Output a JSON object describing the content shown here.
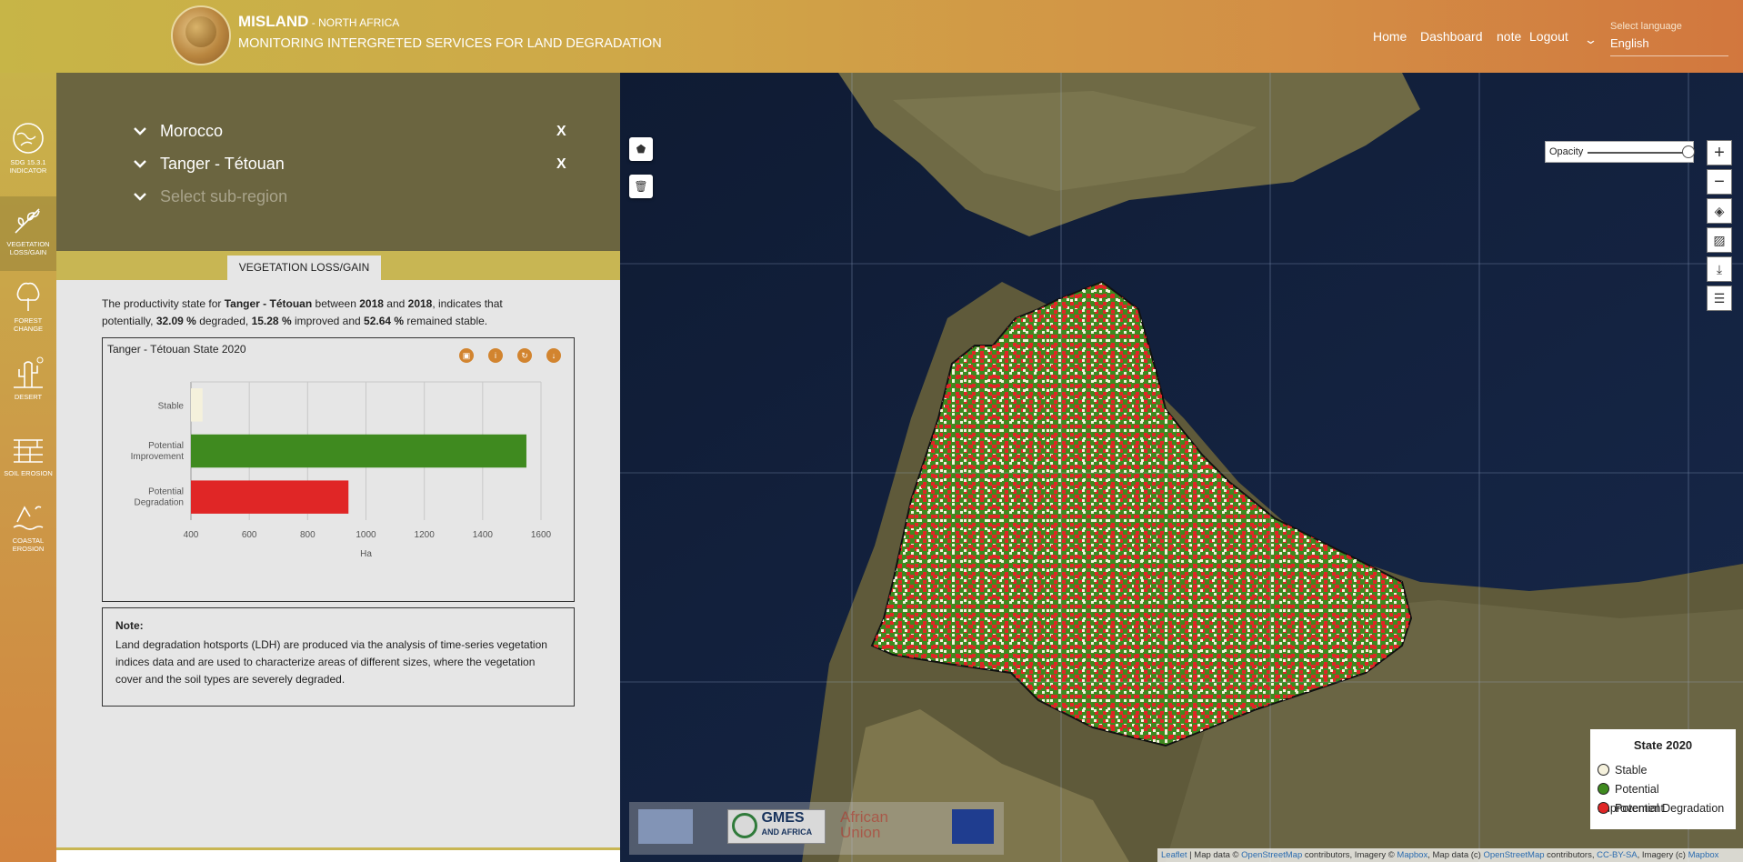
{
  "header": {
    "brand": "MISLAND",
    "brand_sub": " - NORTH AFRICA",
    "subtitle": "MONITORING INTERGRETED SERVICES FOR LAND DEGRADATION",
    "nav": [
      "Home",
      "Dashboard",
      "note",
      "Logout"
    ],
    "language_label": "Select language",
    "language_value": "English"
  },
  "sidebar": {
    "items": [
      {
        "label": "SDG 15.3.1 INDICATOR",
        "icon": "globe-icon"
      },
      {
        "label": "VEGETATION LOSS/GAIN",
        "icon": "plant-icon"
      },
      {
        "label": "FOREST CHANGE",
        "icon": "tree-icon"
      },
      {
        "label": "DESERT",
        "icon": "cactus-icon"
      },
      {
        "label": "SOIL EROSION",
        "icon": "soil-icon"
      },
      {
        "label": "COASTAL EROSION",
        "icon": "coast-icon"
      }
    ]
  },
  "regions": {
    "country": "Morocco",
    "region": "Tanger - Tétouan",
    "subregion_placeholder": "Select sub-region",
    "clear": "X"
  },
  "tab": "VEGETATION LOSS/GAIN",
  "summary": {
    "p1": "The productivity state for ",
    "region": "Tanger - Tétouan",
    "p2": " between ",
    "year_start": "2018",
    "p3": " and ",
    "year_end": "2018",
    "p4": ", indicates that potentially, ",
    "degraded": "32.09 %",
    "p5": " degraded, ",
    "improved": "15.28 %",
    "p6": " improved and ",
    "stable": "52.64 %",
    "p7": " remained stable."
  },
  "chart_data": {
    "type": "bar",
    "orientation": "horizontal",
    "title": "Tanger - Tétouan State 2020",
    "categories": [
      "Stable",
      "Potential Improvement",
      "Potential Degradation"
    ],
    "values": [
      440,
      1550,
      940
    ],
    "colors": [
      "#f5f1dc",
      "#3f8a1f",
      "#e02626"
    ],
    "xlabel": "Ha",
    "xlim": [
      400,
      1600
    ],
    "xticks": [
      400,
      600,
      800,
      1000,
      1200,
      1400,
      1600
    ],
    "grid": true
  },
  "chart_buttons": [
    "image-icon",
    "info-icon",
    "refresh-icon",
    "download-icon"
  ],
  "note": {
    "title": "Note:",
    "text": "Land degradation hotsports (LDH) are produced via the analysis of time-series vegetation indices data and are used to characterize areas of different sizes, where the vegetation cover and the soil types are severely degraded."
  },
  "map": {
    "opacity_label": "Opacity",
    "opacity_value": 0.95,
    "legend": {
      "title": "State 2020",
      "items": [
        {
          "label": "Stable",
          "color": "#f5f1dc"
        },
        {
          "label": "Potential Improvement",
          "color": "#3f8a1f"
        },
        {
          "label": "Potential Degradation",
          "color": "#e02626"
        }
      ]
    },
    "partner_logos": {
      "gmes_line1": "GMES",
      "gmes_line2": "AND AFRICA",
      "au_line1": "African",
      "au_line2": "Union"
    },
    "attribution": {
      "leaflet": "Leaflet",
      "t1": " | Map data © ",
      "osm": "OpenStreetMap",
      "t2": " contributors, Imagery © ",
      "mapbox": "Mapbox",
      "t3": ", Map data (c) ",
      "osm2": "OpenStreetMap",
      "t4": " contributors, ",
      "ccbysa": "CC-BY-SA",
      "t5": ", Imagery (c) ",
      "mapbox2": "Mapbox"
    }
  }
}
